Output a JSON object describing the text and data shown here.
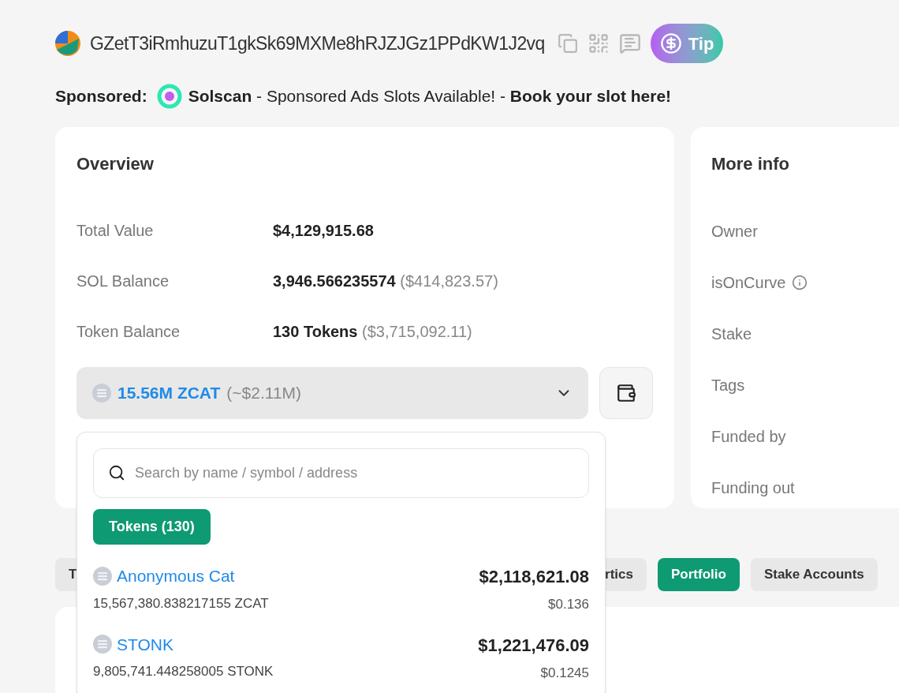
{
  "header": {
    "address": "GZetT3iRmhuzuT1gkSk69MXMe8hRJZJGz1PPdKW1J2vq",
    "tip_button": "Tip"
  },
  "sponsored": {
    "label": "Sponsored:",
    "brand": "Solscan",
    "text": " - Sponsored Ads Slots Available! - ",
    "link": "Book your slot here!"
  },
  "overview": {
    "title": "Overview",
    "rows": [
      {
        "label": "Total Value",
        "value": "$4,129,915.68"
      },
      {
        "label": "SOL Balance",
        "value": "3,946.566235574",
        "note": "($414,823.57)"
      },
      {
        "label": "Token Balance",
        "value": "130 Tokens",
        "note": "($3,715,092.11)"
      }
    ],
    "token_select": {
      "value": "15.56M ZCAT",
      "note": "(~$2.11M)",
      "expanded": true
    }
  },
  "more_info": {
    "title": "More info",
    "rows": [
      {
        "label": "Owner",
        "info": false
      },
      {
        "label": "isOnCurve",
        "info": true
      },
      {
        "label": "Stake",
        "info": false
      },
      {
        "label": "Tags",
        "info": false
      },
      {
        "label": "Funded by",
        "info": false
      },
      {
        "label": "Funding out",
        "info": false
      }
    ]
  },
  "tabs": [
    {
      "label": "T",
      "selected": false
    },
    {
      "label": "rtics",
      "selected": false
    },
    {
      "label": "Portfolio",
      "selected": true
    },
    {
      "label": "Stake Accounts",
      "selected": false
    }
  ],
  "dropdown": {
    "search": {
      "placeholder": "Search by name / symbol / address"
    },
    "filters": [
      {
        "label": "Tokens (130)",
        "selected": true
      }
    ],
    "tokens": [
      {
        "name": "Anonymous Cat",
        "amount": "15,567,380.838217155 ZCAT",
        "value": "$2,118,621.08",
        "price": "$0.136"
      },
      {
        "name": "STONK",
        "amount": "9,805,741.448258005 STONK",
        "value": "$1,221,476.09",
        "price": "$0.1245"
      }
    ]
  }
}
